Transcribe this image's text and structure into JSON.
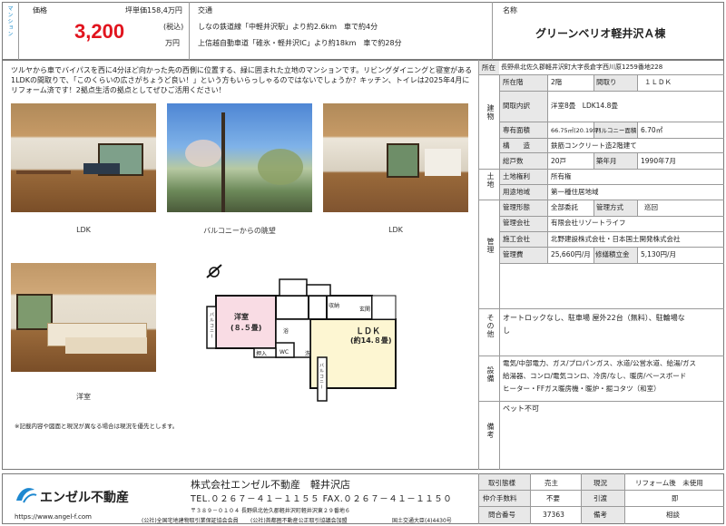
{
  "header": {
    "vertical_tag": "マンション",
    "price_label": "価格",
    "price_value": "3,200",
    "tsubo_label": "坪単価158,4万円",
    "tax_label": "(税込)",
    "unit_label": "万円",
    "transport_label": "交通",
    "transport_line1": "しなの鉄道線「中軽井沢駅」より約2.6km　車で約4分",
    "transport_line2": "上信越自動車道「碓氷・軽井沢IC」より約18km　車で約28分",
    "name_label": "名称",
    "name_value": "グリーンベリオ軽井沢Ａ棟"
  },
  "description": "ツルヤから車でバイパスを西に4分ほど向かった先の西側に位置する、緑に囲まれた立地のマンションです。リビングダイニングと寝室がある1LDKの間取りで、「このくらいの広さがちょうど良い！」という方もいらっしゃるのではないでしょうか？キッチン、トイレは2025年4月にリフォーム済です！2拠点生活の拠点としてぜひご活用ください！",
  "photos": {
    "cap1": "LDK",
    "cap2": "バルコニーからの眺望",
    "cap3": "LDK",
    "cap4": "洋室"
  },
  "floorplan": {
    "room1": "洋室",
    "room1_size": "(８.５畳)",
    "room2": "ＬＤＫ",
    "room2_size": "(約14.８畳)",
    "balcony": "バルコニー",
    "closet": "押入",
    "storage": "収納",
    "entrance": "玄関",
    "washer": "洗",
    "wc": "WC",
    "bath": "浴"
  },
  "notice": "※記載内容や図面と現況が異なる場合は現況を優先とします。",
  "spec": {
    "address_label": "所在",
    "address_value": "長野県北佐久郡軽井沢町大字長倉字西川原1259番地228",
    "building_label": "建物",
    "floor_label": "所在階",
    "floor_value": "2階",
    "layout_label": "間取り",
    "layout_value": "１ＬＤＫ",
    "rooms_label": "間取内訳",
    "rooms_value": "洋室8畳　LDK14.8畳",
    "area_label": "専有面積",
    "area_value": "66.75㎡(20.19坪)",
    "balcony_label": "バルコニー面積",
    "balcony_value": "6.70㎡",
    "structure_label": "構　　造",
    "structure_value": "鉄筋コンクリート造2階建て",
    "units_label": "総戸数",
    "units_value": "20戸",
    "built_label": "築年月",
    "built_value": "1990年7月",
    "land_label": "土地",
    "rights_label": "土地権利",
    "rights_value": "所有権",
    "zone_label": "用途地域",
    "zone_value": "第一種住居地域",
    "mgmt_label": "管理",
    "form_label": "管理形態",
    "form_value": "全部委託",
    "method_label": "管理方式",
    "method_value": "巡回",
    "company_label": "管理会社",
    "company_value": "有限会社リゾートライフ",
    "builder_label": "施工会社",
    "builder_value": "北野建設株式会社・日本国土開発株式会社",
    "fee_label": "管理費",
    "fee_value": "25,660円/月",
    "repair_label": "修繕積立金",
    "repair_value": "5,130円/月",
    "other_label": "その他",
    "other_line1": "オートロックなし、駐車場 屋外22台（無料）、駐輪場な",
    "other_line2": "し",
    "equip_label": "設備",
    "equip_line1": "電気/中部電力、ガス/プロパンガス、水道/公営水道、給湯/ガス",
    "equip_line2": "給湯器、コンロ/電気コンロ、冷房/なし、暖房/ベースボード",
    "equip_line3": "ヒーター・FFガス暖房機・暖炉・掘コタツ（和室）",
    "remarks_label": "備考",
    "remarks_value": "ペット不可"
  },
  "footer": {
    "logo_text": "エンゼル不動産",
    "url": "https://www.angel-f.com",
    "company": "株式会社エンゼル不動産　軽井沢店",
    "tel": "TEL.０２６７－４１－１１５５ FAX.０２６７－４１－１１５０",
    "address": "〒３８９－０１０４ 長野県北佐久郡軽井沢町軽井沢東２９番地６",
    "assoc1": "(公社)全国宅地建物取引業保証協会会員",
    "assoc2": "(公社)首都圏不動産公正取引協議会加盟",
    "license": "国土交通大臣(4)4430号",
    "deal_label": "取引態様",
    "deal_value": "売主",
    "status_label": "現況",
    "status_value": "リフォーム後　未使用",
    "commission_label": "仲介手数料",
    "commission_value": "不要",
    "handover_label": "引渡",
    "handover_value": "即",
    "inquiry_label": "問合番号",
    "inquiry_value": "37363",
    "note_label": "備考",
    "note_value": "相談"
  }
}
